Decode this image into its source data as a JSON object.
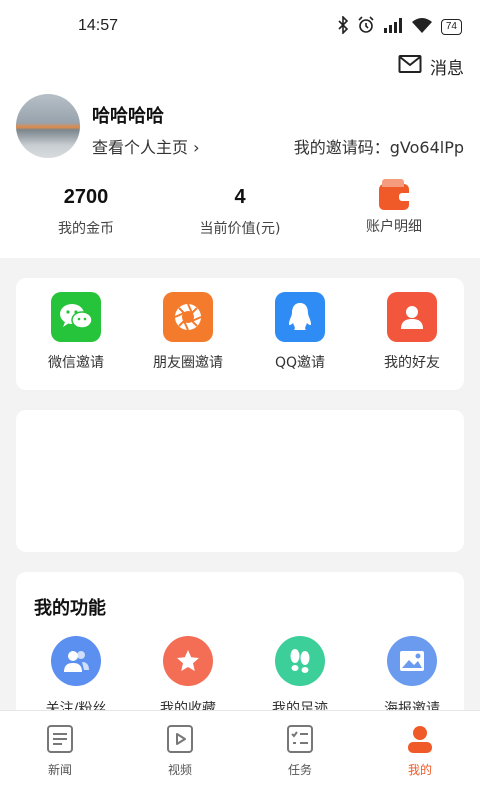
{
  "status_bar": {
    "time": "14:57",
    "battery": "74"
  },
  "header": {
    "message_label": "消息"
  },
  "profile": {
    "name": "哈哈哈哈",
    "homepage_link": "查看个人主页",
    "invite_code": "我的邀请码：gVo64lPp"
  },
  "stats": [
    {
      "value": "2700",
      "label": "我的金币"
    },
    {
      "value": "4",
      "label": "当前价值(元)"
    },
    {
      "label": "账户明细",
      "icon": "wallet-icon"
    }
  ],
  "share": [
    {
      "label": "微信邀请",
      "icon": "wechat-icon",
      "color": "#25c43b"
    },
    {
      "label": "朋友圈邀请",
      "icon": "moments-icon",
      "color": "#f57b2c"
    },
    {
      "label": "QQ邀请",
      "icon": "qq-icon",
      "color": "#2f8cf5"
    },
    {
      "label": "我的好友",
      "icon": "friend-icon",
      "color": "#f2563c"
    }
  ],
  "functions": {
    "title": "我的功能",
    "items": [
      {
        "label": "关注/粉丝",
        "icon": "followers-icon",
        "color": "#5b8ff0"
      },
      {
        "label": "我的收藏",
        "icon": "star-icon",
        "color": "#f36e55"
      },
      {
        "label": "我的足迹",
        "icon": "footprint-icon",
        "color": "#3ccf9a"
      },
      {
        "label": "海报邀请",
        "icon": "poster-icon",
        "color": "#6a9bef"
      }
    ]
  },
  "tabs": [
    {
      "label": "新闻",
      "icon": "news-icon"
    },
    {
      "label": "视频",
      "icon": "video-icon"
    },
    {
      "label": "任务",
      "icon": "task-icon"
    },
    {
      "label": "我的",
      "icon": "profile-icon",
      "active": true
    }
  ],
  "colors": {
    "accent": "#f05a28",
    "background": "#f3f3f3"
  }
}
